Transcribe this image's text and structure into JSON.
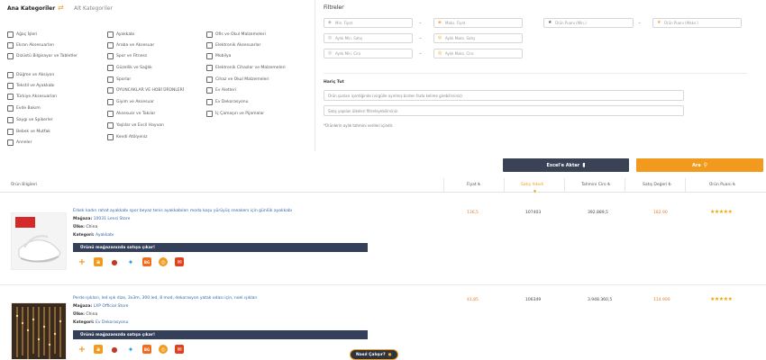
{
  "categories": {
    "main_label": "Ana Kategoriler",
    "sub_label": "Alt Kategoriler",
    "col1": [
      "Ağaç İşleri",
      "Ekran Aksesuarları",
      "Dizüstü Bilgisayar ve Tabletler",
      "Düğme ve Aksiyon",
      "Tekstil ve Ayakkabı",
      "Türkiye Aksesuarları",
      "Evde Bakım",
      "Saygı ve Spikerler",
      "Bebek ve Mutfak",
      "Anneler"
    ],
    "col2": [
      "Ayakkabı",
      "Araba ve Aksesuar",
      "Spor ve Fitness",
      "Güzellik ve Sağlık",
      "Sporlar",
      "OYUNCAKLAR VE HOBİ ÜRÜNLERİ",
      "Giyim ve Aksesuar",
      "Aksesuar ve Takılar",
      "Yaşlılar ve Evcil Hayvan",
      "Kendi Atölyeniz"
    ],
    "col3": [
      "Ofis ve Okul Malzemeleri",
      "Elektronik Aksesuarlar",
      "Mobilya",
      "Elektronik Cihazlar ve Malzemeleri",
      "Cihaz ve Okul Malzemeleri",
      "Ev Aletleri",
      "Ev Dekorasyonu",
      "İç Çamaşırı ve Pijamalar"
    ]
  },
  "filters": {
    "title": "Filtreler",
    "min_price": "Min. Fiyat",
    "max_price": "Maks. Fiyat",
    "min_sales": "Aylık Min. Satış",
    "max_sales": "Aylık Maks. Satış",
    "min_revenue": "Aylık Min. Ciro",
    "max_revenue": "Aylık Maks. Ciro",
    "min_score": "Ürün Puanı (Min.)",
    "max_score": "Ürün Puanı (Maks.)",
    "exclude_label": "Hariç Tut",
    "exclude_placeholder": "Ürün şunları içerdiğinde (virgülle ayrılmış birden fazla kelime girebilirsiniz)",
    "search_placeholder": "Satış yapılan ülkeleri filtreleyebilirsiniz.",
    "note": "*Ürünlerin aylık tahmini verileri içindir."
  },
  "actions": {
    "export_label": "Excel'e Aktar",
    "search_label": "Ara",
    "export_color": "#3a4355",
    "search_color": "#f29a1d"
  },
  "table": {
    "headers": [
      "Ürün Bilgileri",
      "Fiyat ₺",
      "Satış Adedi",
      "Tahmini Ciro ₺",
      "Satış Değeri ₺",
      "Ürün Puanı ₺"
    ],
    "rows": [
      {
        "title": "Erkek kadın rahat ayakkabı spor beyaz tenis ayakkabıları moda koşu yürüyüş sneakers için günlük ayakkabı",
        "store_label": "Mağaza:",
        "store_value": "10031 Lensi Store",
        "country_label": "Ülke:",
        "country_value": "China",
        "category_label": "Kategori:",
        "category_value": "Ayakkabı",
        "banner": "Ürünü mağazanızda satışa çıkar!",
        "price": "136,5",
        "sales": "107403",
        "revenue": "392.889,5",
        "value": "182.90",
        "stars": "★★★★★"
      },
      {
        "title": "Perde ışıkları, led ışık dize, 3x3m, 300 led, 8 mod, dekorasyon yatak odası için, noel ışıkları",
        "store_label": "Mağaza:",
        "store_value": "LXP Official Store",
        "country_label": "Ülke:",
        "country_value": "China",
        "category_label": "Kategori:",
        "category_value": "Ev Dekorasyonu",
        "banner": "Ürünü mağazanızda satışa çıkar!",
        "price": "41,85",
        "sales": "106349",
        "revenue": "3.948.360,5",
        "value": "114.900",
        "stars": "★★★★★"
      }
    ]
  },
  "help": "Nasıl Çalışır?"
}
